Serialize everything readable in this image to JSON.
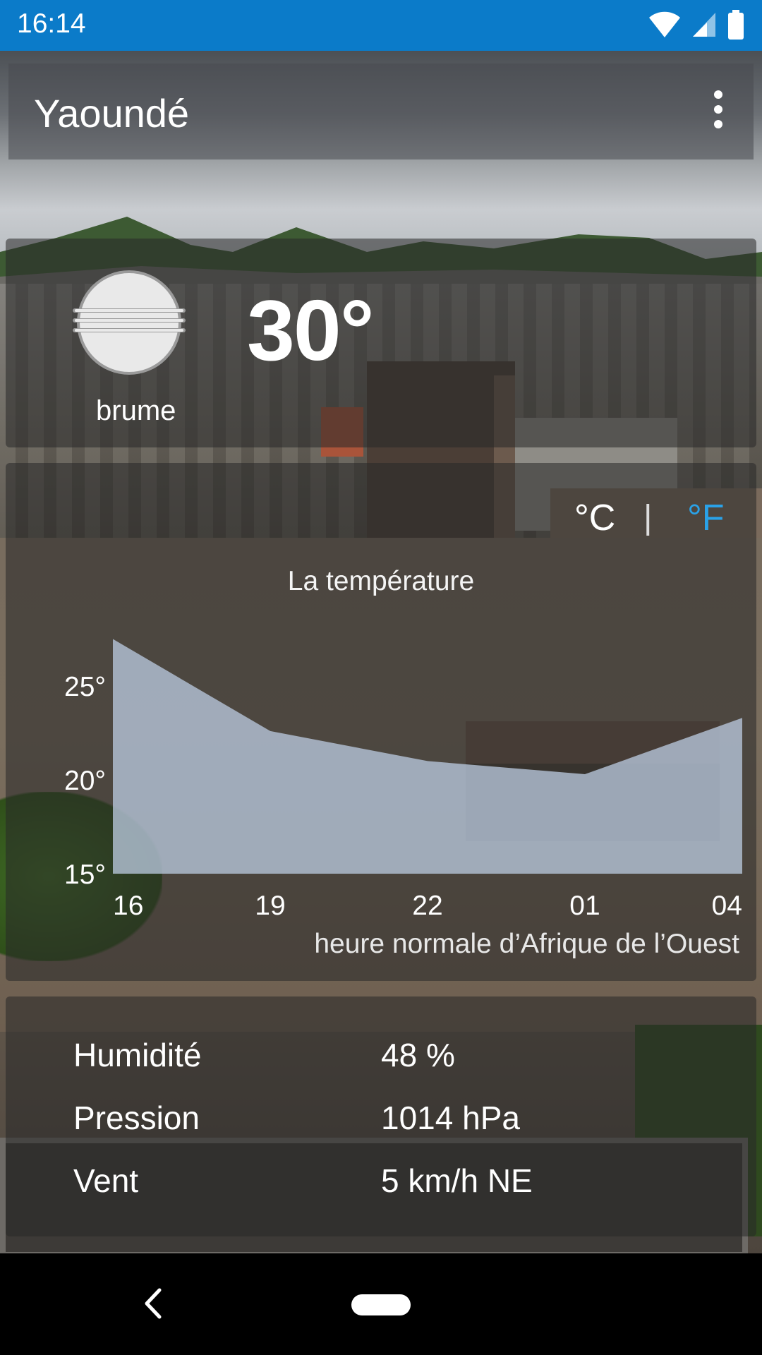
{
  "status_bar": {
    "time": "16:14"
  },
  "toolbar": {
    "city": "Yaoundé"
  },
  "current": {
    "temperature": "30°",
    "condition": "brume",
    "icon": "fog-icon"
  },
  "units": {
    "celsius": "°C",
    "separator": "|",
    "fahrenheit": "°F",
    "selected": "fahrenheit",
    "selected_color": "#2aa2e8"
  },
  "chart_data": {
    "type": "area",
    "title": "La température",
    "x": [
      "16",
      "19",
      "22",
      "01",
      "04"
    ],
    "values": [
      27.5,
      22.6,
      21.0,
      20.3,
      23.3
    ],
    "ylim": [
      15,
      28
    ],
    "yticks": [
      "25°",
      "20°",
      "15°"
    ],
    "ytick_values": [
      25,
      20,
      15
    ],
    "xlabel": "heure normale d’Afrique de l’Ouest",
    "fill_color": "#b8c8dc"
  },
  "details": [
    {
      "label": "Humidité",
      "value": "48 %"
    },
    {
      "label": "Pression",
      "value": "1014 hPa"
    },
    {
      "label": "Vent",
      "value": "5 km/h NE"
    }
  ]
}
